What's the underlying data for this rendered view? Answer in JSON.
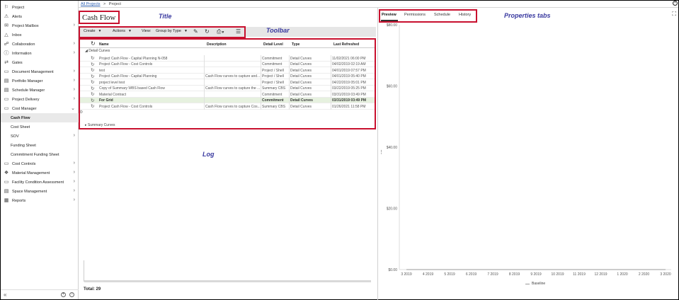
{
  "breadcrumb": {
    "root": "All Projects",
    "sep": ">",
    "current": "Project"
  },
  "annotations": {
    "title": "Title",
    "toolbar": "Toolbar",
    "log": "Log",
    "properties_tabs": "Properties tabs"
  },
  "page_title": "Cash Flow",
  "sidebar": {
    "items": [
      {
        "label": "Project",
        "icon": "project-icon"
      },
      {
        "label": "Alerts",
        "icon": "alert-icon"
      },
      {
        "label": "Project Mailbox",
        "icon": "mail-icon",
        "chevron": true
      },
      {
        "label": "Inbox",
        "icon": "inbox-icon"
      },
      {
        "label": "Collaboration",
        "icon": "collaboration-icon",
        "chevron": true
      },
      {
        "label": "Information",
        "icon": "info-icon",
        "chevron": true
      },
      {
        "label": "Gates",
        "icon": "gates-icon"
      },
      {
        "label": "Document Management",
        "icon": "folder-icon",
        "chevron": true
      },
      {
        "label": "Portfolio Manager",
        "icon": "doc-icon",
        "chevron": true
      },
      {
        "label": "Schedule Manager",
        "icon": "doc-icon",
        "chevron": true
      },
      {
        "label": "Project Delivery",
        "icon": "folder-icon",
        "chevron": true
      },
      {
        "label": "Cost Manager",
        "icon": "folder-icon",
        "chevron": "down"
      },
      {
        "label": "Cash Flow",
        "sub": true,
        "active": true
      },
      {
        "label": "Cost Sheet",
        "sub": true
      },
      {
        "label": "SOV",
        "sub": true,
        "chevron": true
      },
      {
        "label": "Funding Sheet",
        "sub": true
      },
      {
        "label": "Commitment Funding Sheet",
        "sub": true
      },
      {
        "label": "Cost Controls",
        "icon": "folder-icon",
        "chevron": true
      },
      {
        "label": "Material Management",
        "icon": "boxes-icon",
        "chevron": true
      },
      {
        "label": "Facility Condition Assessment",
        "icon": "folder-icon",
        "chevron": true
      },
      {
        "label": "Space Management",
        "icon": "doc-icon",
        "chevron": true
      },
      {
        "label": "Reports",
        "icon": "report-icon",
        "chevron": true
      }
    ],
    "footer": {
      "collapse": "«",
      "add": "+",
      "remove": "−"
    }
  },
  "toolbar": {
    "create": "Create",
    "actions": "Actions",
    "view_label": "View:",
    "view_value": "Group by Type"
  },
  "grid": {
    "columns": [
      "Name",
      "Description",
      "Detail Level",
      "Type",
      "Last Refreshed"
    ],
    "group_detail": "Detail Curves",
    "group_summary": "Summary Curves",
    "rows": [
      {
        "name": "Project Cash Flow - Capital Planning  N-058",
        "desc": "",
        "level": "Commitment",
        "type": "Detail Curves",
        "date": "11/02/2021 06:00 PM"
      },
      {
        "name": "Project Cash Flow - Cost Controls",
        "desc": "",
        "level": "Commitment",
        "type": "Detail Curves",
        "date": "04/02/2019 02:19 AM"
      },
      {
        "name": "test",
        "desc": "",
        "level": "Project / Shell",
        "type": "Detail Curves",
        "date": "04/01/2019 07:57 PM"
      },
      {
        "name": "Project Cash Flow - Capital Planning",
        "desc": "Cash Flow curves to capture and...",
        "level": "Project / Shell",
        "type": "Detail Curves",
        "date": "04/01/2019 05:40 PM"
      },
      {
        "name": "project level test",
        "desc": "",
        "level": "Project / Shell",
        "type": "Detail Curves",
        "date": "04/22/2019 05:01 PM"
      },
      {
        "name": "Copy of Summary WBS based Cash Flow",
        "desc": "Cash Flow curves to capture the ...",
        "level": "Summary CBS",
        "type": "Detail Curves",
        "date": "03/22/2019 05:25 PM"
      },
      {
        "name": "Material Contract",
        "desc": "",
        "level": "Commitment",
        "type": "Detail Curves",
        "date": "03/31/2019 03:49 PM"
      },
      {
        "name": "For Grid",
        "desc": "",
        "level": "Commitment",
        "type": "Detail Curves",
        "date": "03/31/2019 03:49 PM",
        "selected": true
      },
      {
        "name": "Project Cash Flow - Cost Controls",
        "desc": "Cash Flow curves to capture Cos...",
        "level": "Summary CBS",
        "type": "Detail Curves",
        "date": "01/26/2021 11:58 PM"
      }
    ],
    "total": "Total: 29"
  },
  "tabs": [
    "Preview",
    "Permissions",
    "Schedule",
    "History"
  ],
  "chart_data": {
    "type": "line",
    "y_ticks": [
      "$80.00",
      "$60.00",
      "$40.00",
      "$20.00",
      "$0.00"
    ],
    "x_ticks": [
      "3 2019",
      "4 2019",
      "5 2019",
      "6 2019",
      "7 2019",
      "8 2019",
      "9 2019",
      "10 2019",
      "11 2019",
      "12 2019",
      "1 2020",
      "2 2020",
      "3 2020"
    ],
    "series": [
      {
        "name": "Baseline",
        "values": [
          0,
          0,
          0,
          0,
          0,
          0,
          0,
          0,
          0,
          0,
          0,
          0,
          0
        ]
      }
    ],
    "ylim": [
      0,
      80
    ],
    "grid": false,
    "legend": "bottom"
  }
}
